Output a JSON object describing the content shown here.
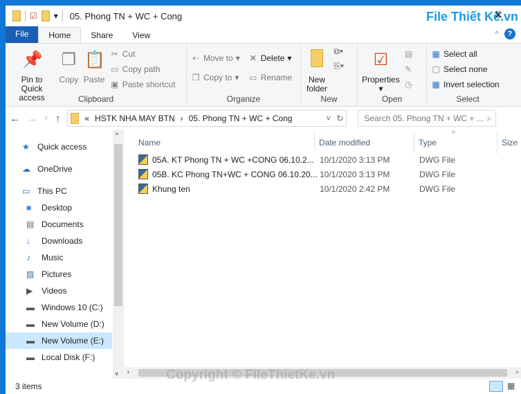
{
  "window": {
    "title": "05. Phong TN + WC + Cong",
    "logo": "File Thiết Kế.vn"
  },
  "tabs": [
    {
      "label": "File"
    },
    {
      "label": "Home"
    },
    {
      "label": "Share"
    },
    {
      "label": "View"
    }
  ],
  "ribbon": {
    "clipboard": {
      "label": "Clipboard",
      "pin": "Pin to Quick access",
      "copy": "Copy",
      "paste": "Paste",
      "cut": "Cut",
      "copy_path": "Copy path",
      "paste_shortcut": "Paste shortcut"
    },
    "organize": {
      "label": "Organize",
      "move_to": "Move to",
      "copy_to": "Copy to",
      "delete": "Delete",
      "rename": "Rename"
    },
    "new": {
      "label": "New",
      "new_folder": "New folder"
    },
    "open": {
      "label": "Open",
      "properties": "Properties"
    },
    "select": {
      "label": "Select",
      "select_all": "Select all",
      "select_none": "Select none",
      "invert": "Invert selection"
    }
  },
  "address": {
    "prefix": "«",
    "crumbs": [
      "HSTK NHA MAY BTN",
      "05. Phong TN + WC + Cong"
    ],
    "search_placeholder": "Search 05. Phong TN + WC + ..."
  },
  "sidebar": {
    "items": [
      {
        "label": "Quick access",
        "icon": "star-icon"
      },
      {
        "label": "OneDrive",
        "icon": "cloud-icon"
      },
      {
        "label": "This PC",
        "icon": "computer-icon"
      },
      {
        "label": "Desktop",
        "icon": "desktop-icon"
      },
      {
        "label": "Documents",
        "icon": "documents-icon"
      },
      {
        "label": "Downloads",
        "icon": "downloads-icon"
      },
      {
        "label": "Music",
        "icon": "music-icon"
      },
      {
        "label": "Pictures",
        "icon": "pictures-icon"
      },
      {
        "label": "Videos",
        "icon": "videos-icon"
      },
      {
        "label": "Windows 10 (C:)",
        "icon": "drive-icon"
      },
      {
        "label": "New Volume (D:)",
        "icon": "drive-icon"
      },
      {
        "label": "New Volume (E:)",
        "icon": "drive-icon",
        "selected": true
      },
      {
        "label": "Local Disk (F:)",
        "icon": "drive-icon"
      }
    ]
  },
  "columns": {
    "name": "Name",
    "date": "Date modified",
    "type": "Type",
    "size": "Size"
  },
  "files": [
    {
      "name": "05A. KT Phong TN + WC +CONG 06.10.2...",
      "date": "10/1/2020 3:13 PM",
      "type": "DWG File"
    },
    {
      "name": "05B. KC Phong TN+WC + CONG 06.10.20...",
      "date": "10/1/2020 3:13 PM",
      "type": "DWG File"
    },
    {
      "name": "Khung ten",
      "date": "10/1/2020 2:42 PM",
      "type": "DWG File"
    }
  ],
  "status": {
    "count": "3 items"
  },
  "watermark": "Copyright © FileThietKe.vn"
}
